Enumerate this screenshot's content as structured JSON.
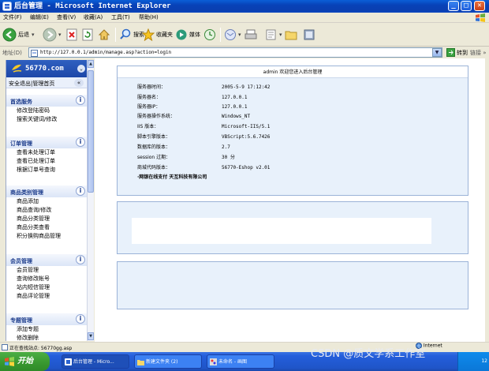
{
  "window": {
    "title": "后台管理 - Microsoft Internet Explorer",
    "controls": [
      "_",
      "□",
      "✕"
    ]
  },
  "menubar": [
    "文件(F)",
    "编辑(E)",
    "查看(V)",
    "收藏(A)",
    "工具(T)",
    "帮助(H)"
  ],
  "toolbar": {
    "back": "后退",
    "search": "搜索",
    "favorites": "收藏夹",
    "media": "媒体"
  },
  "address": {
    "label": "地址(D)",
    "url": "http://127.0.0.1/admin/manage.asp?action=login",
    "go": "转到",
    "links": "链接 »"
  },
  "sidebar": {
    "brand": "56770.com",
    "top_link": "安全退出|管理首页",
    "collapse": "«",
    "sections": [
      {
        "title": "首选服务",
        "items": [
          "修改登陆密码",
          "搜索关键词/修改"
        ]
      },
      {
        "title": "订单管理",
        "items": [
          "查看未处理订单",
          "查看已处理订单",
          "根据订单号查询"
        ]
      },
      {
        "title": "商品类别管理",
        "items": [
          "商品添加",
          "商品查询/修改",
          "商品分类管理",
          "商品分类查看",
          "积分换购商品管理"
        ]
      },
      {
        "title": "会员管理",
        "items": [
          "会员管理",
          "查询修改帐号",
          "站内短信管理",
          "商品评论管理"
        ]
      },
      {
        "title": "专题管理",
        "items": [
          "添加专题",
          "修改删除"
        ]
      }
    ]
  },
  "content": {
    "welcome": "admin 欢迎您进入后台管理",
    "info": [
      {
        "label": "服务器时间：",
        "value": "2005-5-9 17:12:42"
      },
      {
        "label": "服务器名：",
        "value": "127.0.0.1"
      },
      {
        "label": "服务器IP：",
        "value": "127.0.0.1"
      },
      {
        "label": "服务器操作系统：",
        "value": "Windows_NT"
      },
      {
        "label": "IIS 版本：",
        "value": "Microsoft-IIS/5.1"
      },
      {
        "label": "脚本引擎版本：",
        "value": "VBScript:5.6.7426"
      },
      {
        "label": "数据库的版本：",
        "value": "2.7"
      },
      {
        "label": "session 过期：",
        "value": "30 分"
      },
      {
        "label": "商城代码版本：",
        "value": "56770-Eshop v2.01"
      }
    ],
    "footer": "·网银在线支付 天互科技有限公司"
  },
  "statusbar": {
    "text": "正在查找站点: 56770gg.asp",
    "zone": "Internet"
  },
  "taskbar": {
    "start": "开始",
    "tasks": [
      "后台管理 - Micro...",
      "新建文件夹 (2)",
      "未命名 - 画图"
    ],
    "clock": "12"
  },
  "watermark": "CSDN @质文学系工作室",
  "colors": {
    "titlebar": "#0a44b8",
    "sidebar_header": "#1d47a8",
    "panel_bg": "#e8f1fb",
    "taskbar": "#245edb",
    "start_button": "#3b9b32"
  }
}
